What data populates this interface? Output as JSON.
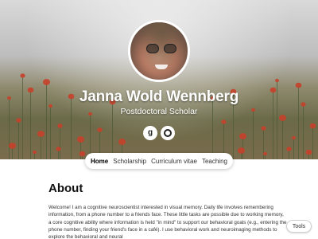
{
  "profile": {
    "name": "Janna Wold Wennberg",
    "title": "Postdoctoral Scholar"
  },
  "social": {
    "scholar_icon": "google-scholar-icon",
    "scholar_glyph": "g",
    "orcid_icon": "orcid-icon"
  },
  "nav": {
    "items": [
      {
        "label": "Home",
        "active": true
      },
      {
        "label": "Scholarship",
        "active": false
      },
      {
        "label": "Curriculum vitae",
        "active": false
      },
      {
        "label": "Teaching",
        "active": false
      }
    ]
  },
  "about": {
    "heading": "About",
    "text": "Welcome! I am a cognitive neuroscientist interested in visual memory. Daily life involves remembering information, from a phone number to a friends face. These little tasks are possible due to working memory, a core cognitive ability where information is held \"in mind\" to support our behavioral goals (e.g., entering the phone number, finding your friend's face in a café). I use behavioral work and neuroimaging methods to explore the behavioral and neural"
  },
  "tools": {
    "label": "Tools"
  },
  "colors": {
    "nav_bg": "#ffffff",
    "hero_text": "#ffffff",
    "poppy": "#c6402a"
  }
}
